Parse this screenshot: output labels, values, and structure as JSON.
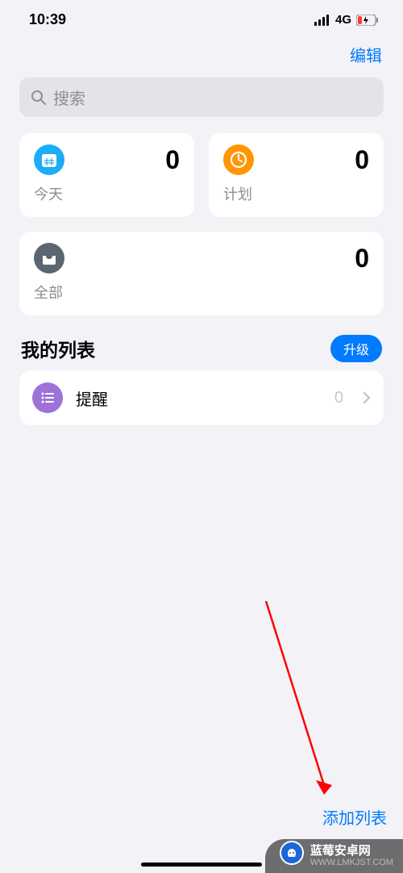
{
  "status": {
    "time": "10:39",
    "network": "4G"
  },
  "header": {
    "edit_label": "编辑"
  },
  "search": {
    "placeholder": "搜索"
  },
  "cards": {
    "today": {
      "label": "今天",
      "count": "0"
    },
    "scheduled": {
      "label": "计划",
      "count": "0"
    },
    "all": {
      "label": "全部",
      "count": "0"
    }
  },
  "section": {
    "title": "我的列表",
    "upgrade_label": "升级"
  },
  "lists": [
    {
      "label": "提醒",
      "count": "0"
    }
  ],
  "footer": {
    "add_list_label": "添加列表"
  },
  "watermark": {
    "title": "蓝莓安卓网",
    "url": "WWW.LMKJST.COM"
  }
}
